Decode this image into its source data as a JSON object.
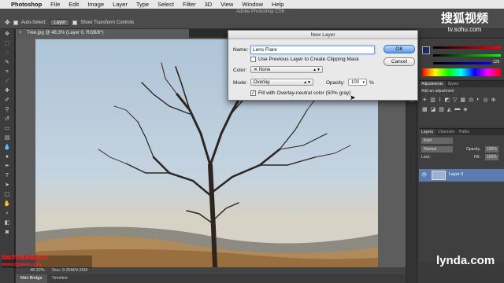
{
  "menubar": {
    "app_name": "Photoshop",
    "items": [
      "File",
      "Edit",
      "Image",
      "Layer",
      "Type",
      "Select",
      "Filter",
      "3D",
      "View",
      "Window",
      "Help"
    ]
  },
  "options_bar": {
    "app_title": "Adobe Photoshop CS6",
    "auto_select_label": "Auto-Select:",
    "auto_select_value": "Layer",
    "show_transform_label": "Show Transform Controls"
  },
  "document": {
    "tab_title": "Tree.jpg @ 48.3% (Layer 0, RGB/8*)",
    "zoom": "48.32%",
    "doc_size": "Doc: 9.35M/9.35M"
  },
  "bottom_tabs": [
    "Mini Bridge",
    "Timeline"
  ],
  "dialog": {
    "title": "New Layer",
    "name_label": "Name:",
    "name_value": "Lens Flare",
    "clipping_label": "Use Previous Layer to Create Clipping Mask",
    "clipping_checked": false,
    "color_label": "Color:",
    "color_value": "None",
    "mode_label": "Mode:",
    "mode_value": "Overlay",
    "opacity_label": "Opacity:",
    "opacity_value": "100",
    "opacity_unit": "%",
    "fill_label": "Fill with Overlay-neutral color (50% gray)",
    "fill_checked": true,
    "ok_label": "OK",
    "cancel_label": "Cancel"
  },
  "panels": {
    "color_value": "125",
    "adjust_tabs": [
      "Adjustments",
      "Styles"
    ],
    "adjust_hint": "Add an adjustment",
    "layer_tabs": [
      "Layers",
      "Channels",
      "Paths"
    ],
    "kind_label": "Kind",
    "blend_mode": "Normal",
    "opacity_label": "Opacity:",
    "opacity_value": "100%",
    "lock_label": "Lock:",
    "fill_label": "Fill:",
    "fill_value": "100%",
    "layer_name": "Layer 0"
  },
  "watermarks": {
    "sohu_title": "搜狐视频",
    "sohu_url": "tv.sohu.com",
    "lynda": "lynda.com",
    "red_line1": "网络学院新闻素材中心",
    "red_line2": "www.cgwww.com"
  },
  "colors": {
    "dialog_default_button": "#5a9ae6",
    "layer_selected": "#5c7cb0"
  }
}
